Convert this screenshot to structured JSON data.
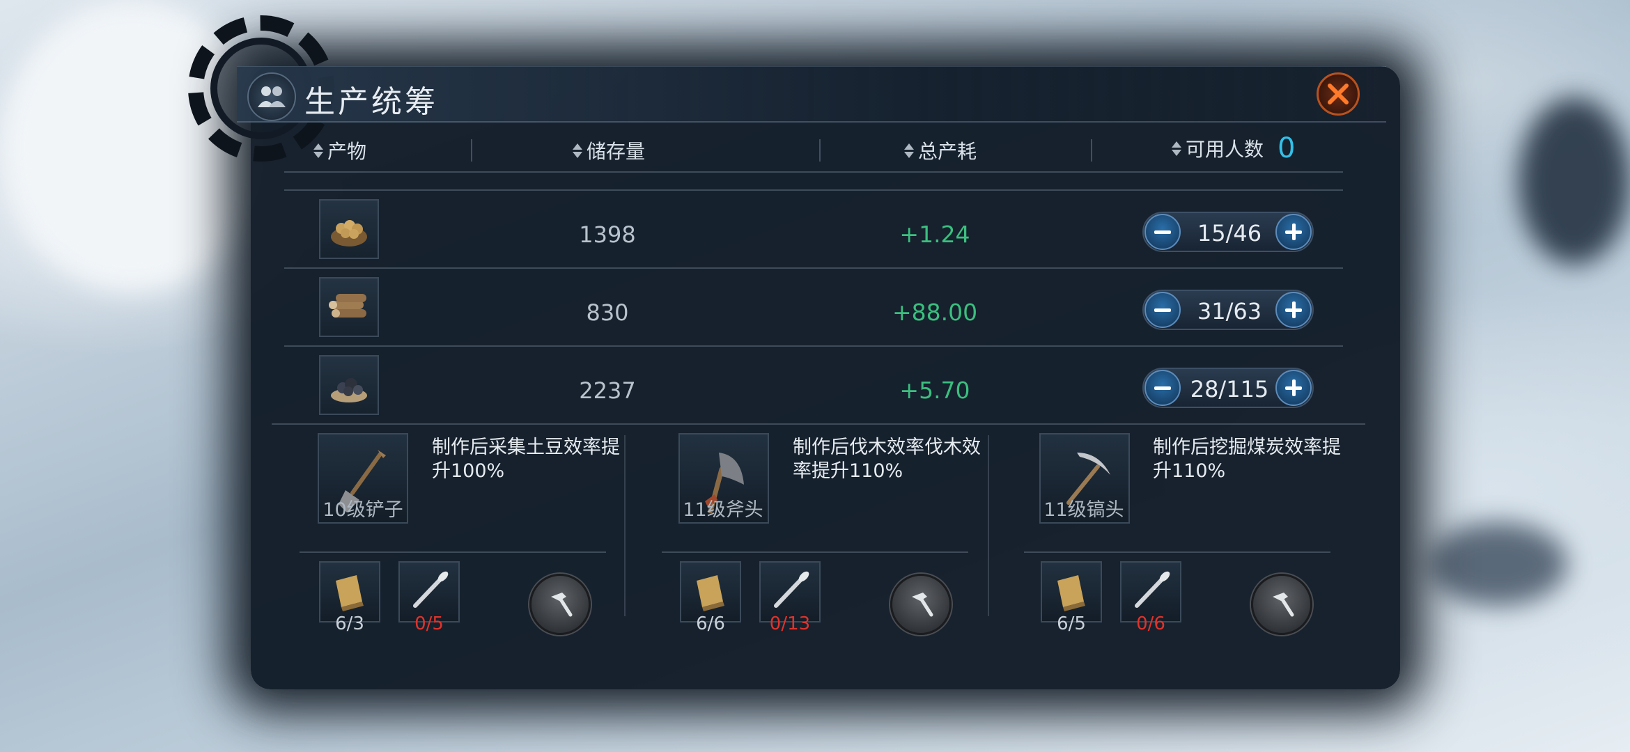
{
  "title": "生产统筹",
  "headers": {
    "product": "产物",
    "stock": "储存量",
    "consumption": "总产耗",
    "workers": "可用人数",
    "workers_available": "0"
  },
  "rows": [
    {
      "icon": "potato-basket-icon",
      "stock": "1398",
      "rate": "+1.24",
      "workers": "15/46"
    },
    {
      "icon": "wood-logs-icon",
      "stock": "830",
      "rate": "+88.00",
      "workers": "31/63"
    },
    {
      "icon": "coal-pile-icon",
      "stock": "2237",
      "rate": "+5.70",
      "workers": "28/115"
    }
  ],
  "tools": [
    {
      "name": "10级铲子",
      "desc": "制作后采集土豆效率提升100%",
      "icon": "shovel-icon",
      "materials": [
        {
          "icon": "wood-plank-icon",
          "count": "6/3",
          "color": "#c8d0d8"
        },
        {
          "icon": "nail-icon",
          "count": "0/5",
          "color": "#e0332b"
        }
      ]
    },
    {
      "name": "11级斧头",
      "desc": "制作后伐木效率伐木效率提升110%",
      "icon": "axe-icon",
      "materials": [
        {
          "icon": "wood-plank-icon",
          "count": "6/6",
          "color": "#c8d0d8"
        },
        {
          "icon": "nail-icon",
          "count": "0/13",
          "color": "#e0332b"
        }
      ]
    },
    {
      "name": "11级镐头",
      "desc": "制作后挖掘煤炭效率提升110%",
      "icon": "pickaxe-icon",
      "materials": [
        {
          "icon": "wood-plank-icon",
          "count": "6/5",
          "color": "#c8d0d8"
        },
        {
          "icon": "nail-icon",
          "count": "0/6",
          "color": "#e0332b"
        }
      ]
    }
  ],
  "colors": {
    "rate_positive": "#3bbf7f",
    "insufficient": "#e0332b",
    "accent": "#33c0e8"
  }
}
